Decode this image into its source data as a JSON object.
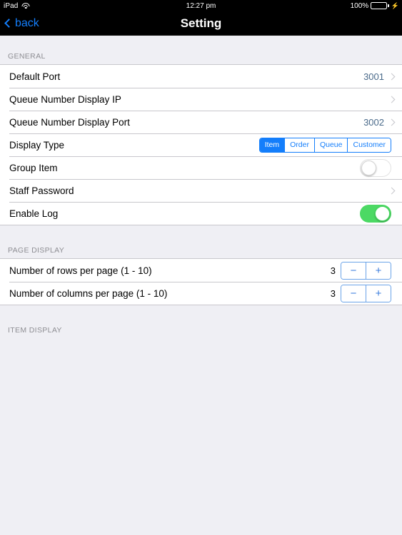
{
  "status_bar": {
    "device": "iPad",
    "wifi_icon": "wifi-icon",
    "time": "12:27 pm",
    "battery_percent": "100%",
    "battery_charging_icon": "lightning-bolt-icon",
    "battery_color": "#4cd964"
  },
  "nav_bar": {
    "back_label": "back",
    "back_icon": "chevron-left-icon",
    "title": "Setting",
    "tint_color": "#147efb"
  },
  "sections": {
    "general": {
      "header": "GENERAL",
      "rows": {
        "default_port": {
          "label": "Default Port",
          "value": "3001",
          "accessory": "chevron-right-icon"
        },
        "queue_ip": {
          "label": "Queue Number Display IP",
          "value": "",
          "accessory": "chevron-right-icon"
        },
        "queue_port": {
          "label": "Queue Number Display Port",
          "value": "3002",
          "accessory": "chevron-right-icon"
        },
        "display_type": {
          "label": "Display Type",
          "options": [
            "Item",
            "Order",
            "Queue",
            "Customer"
          ],
          "selected": "Item"
        },
        "group_item": {
          "label": "Group Item",
          "toggle_on": false
        },
        "staff_password": {
          "label": "Staff Password",
          "value": "",
          "accessory": "chevron-right-icon"
        },
        "enable_log": {
          "label": "Enable Log",
          "toggle_on": true
        }
      }
    },
    "page_display": {
      "header": "PAGE DISPLAY",
      "rows": {
        "rows_per_page": {
          "label": "Number of rows per page (1 - 10)",
          "value": "3",
          "minus_label": "−",
          "plus_label": "+"
        },
        "cols_per_page": {
          "label": "Number of columns per page (1 - 10)",
          "value": "3",
          "minus_label": "−",
          "plus_label": "+"
        }
      }
    },
    "item_display": {
      "header": "ITEM DISPLAY"
    }
  }
}
